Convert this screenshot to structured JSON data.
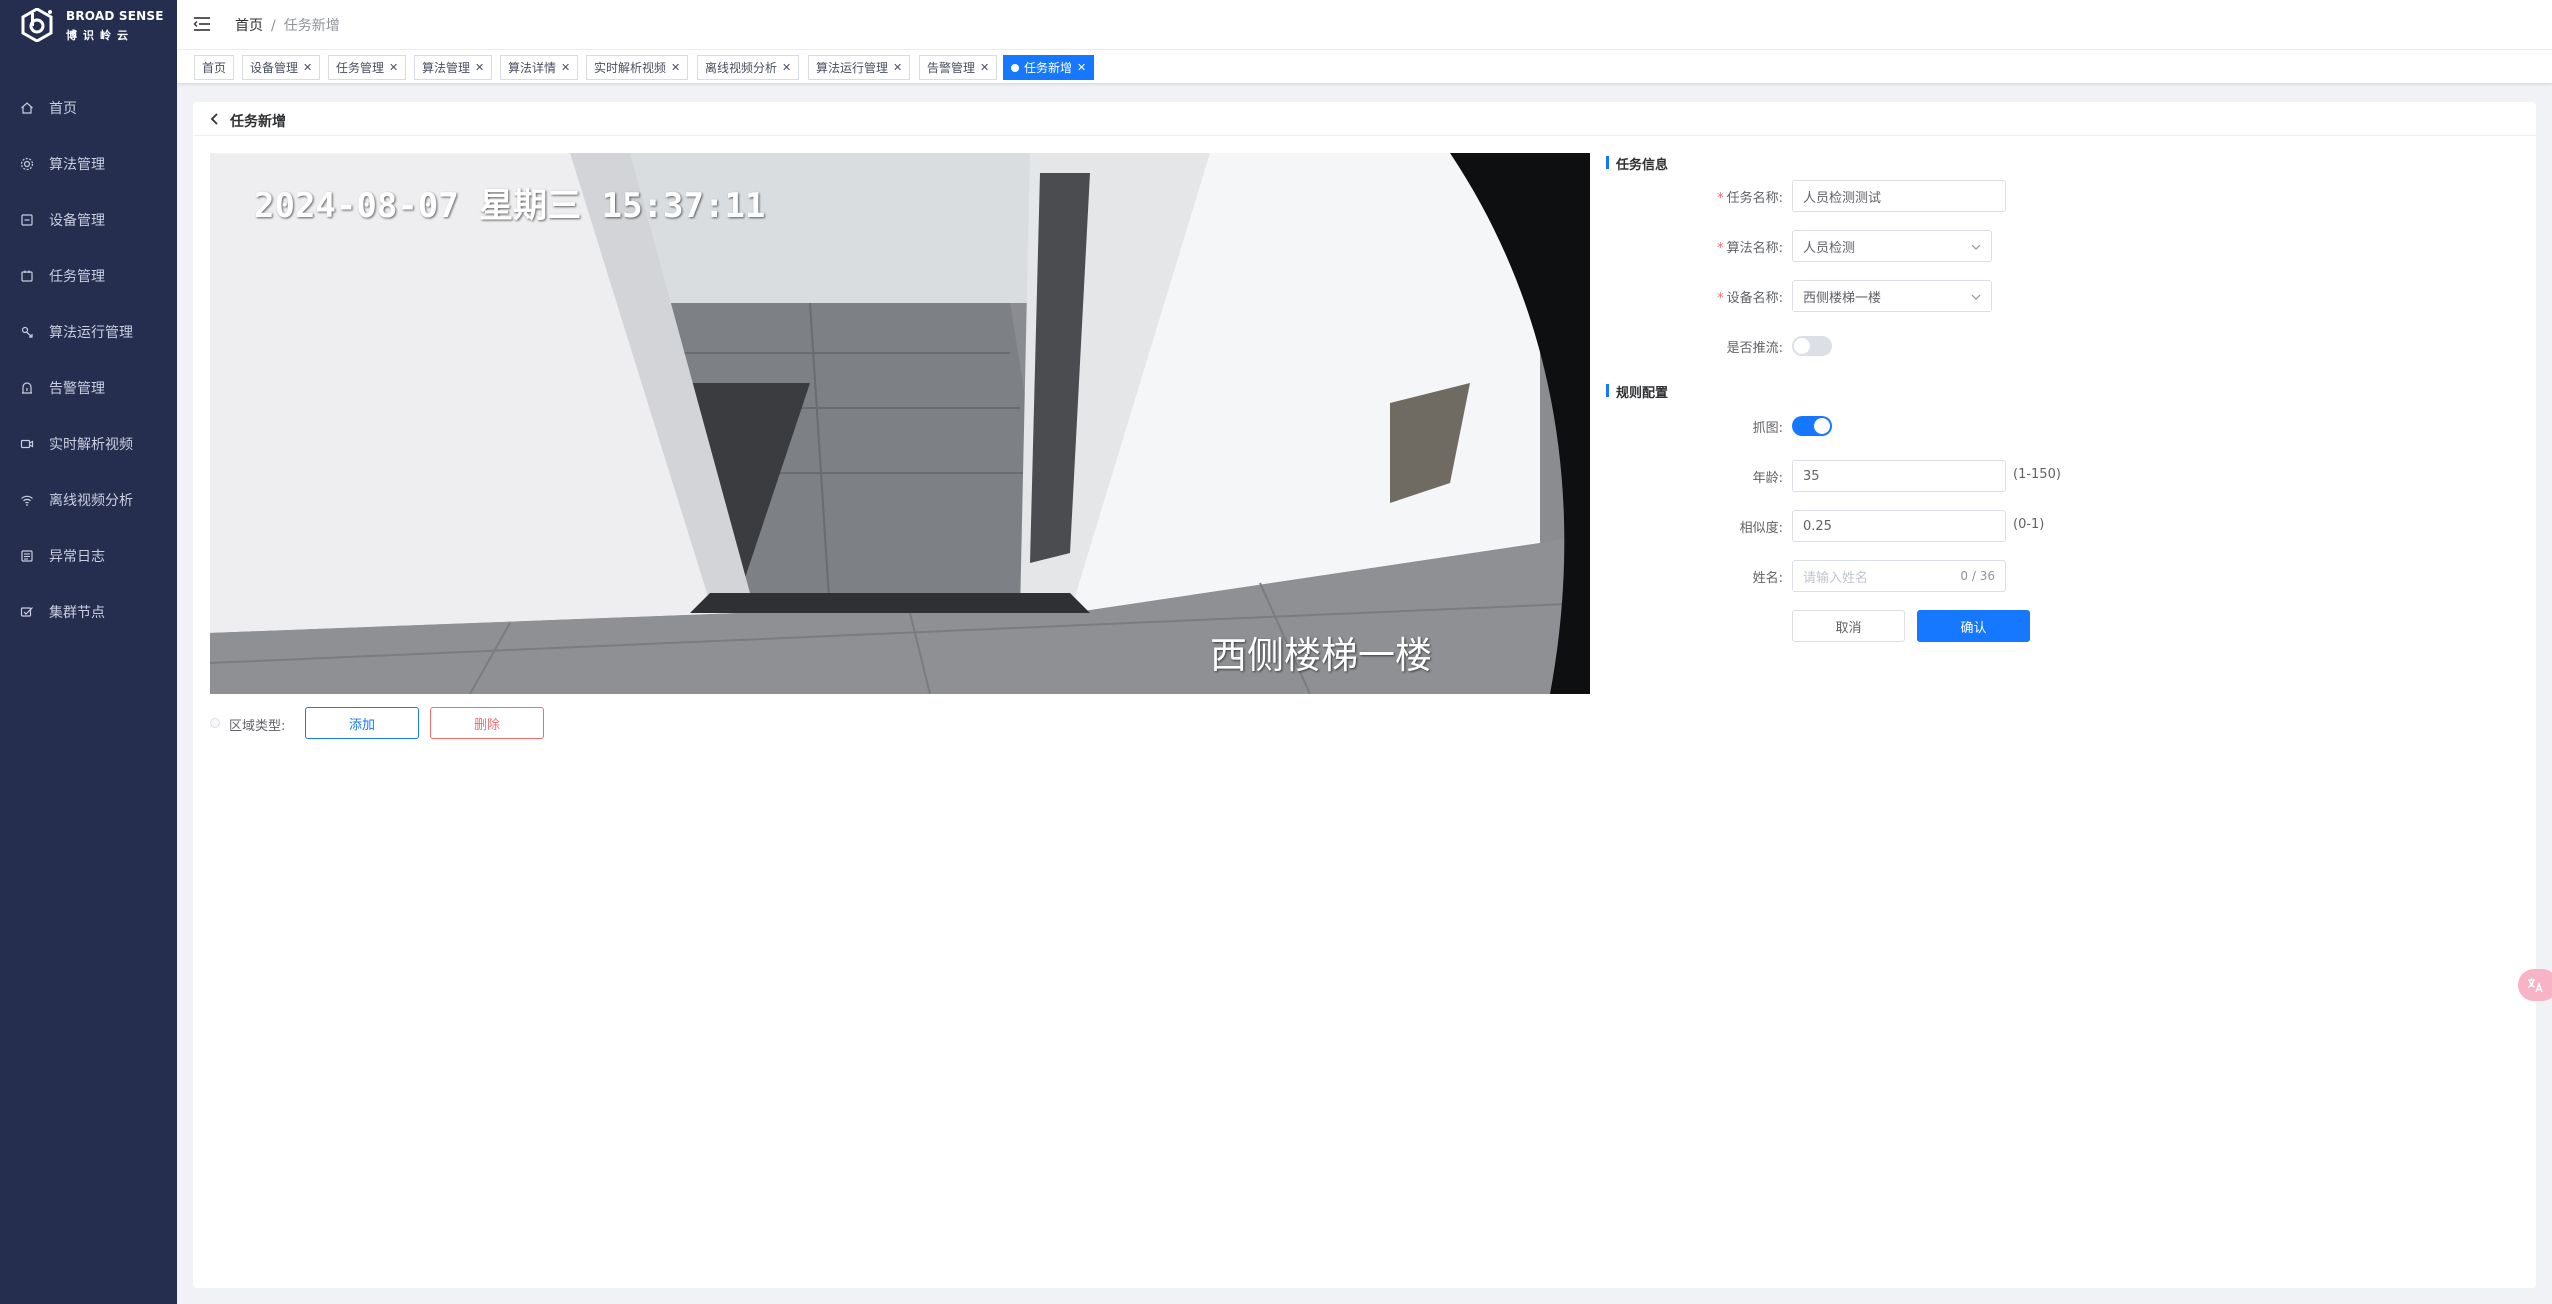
{
  "brand": {
    "name_en": "BROAD SENSE",
    "name_cn": "博识岭云"
  },
  "sidebar": {
    "items": [
      {
        "label": "首页",
        "icon": "home-icon"
      },
      {
        "label": "算法管理",
        "icon": "algorithm-icon"
      },
      {
        "label": "设备管理",
        "icon": "device-icon"
      },
      {
        "label": "任务管理",
        "icon": "task-icon"
      },
      {
        "label": "算法运行管理",
        "icon": "algorithm-run-icon"
      },
      {
        "label": "告警管理",
        "icon": "alarm-icon"
      },
      {
        "label": "实时解析视频",
        "icon": "video-camera-icon"
      },
      {
        "label": "离线视频分析",
        "icon": "wifi-icon"
      },
      {
        "label": "异常日志",
        "icon": "log-icon"
      },
      {
        "label": "集群节点",
        "icon": "cluster-icon"
      }
    ]
  },
  "breadcrumb": {
    "home": "首页",
    "separator": "/",
    "current": "任务新增"
  },
  "tags": [
    {
      "label": "首页",
      "closable": false,
      "active": false
    },
    {
      "label": "设备管理",
      "closable": true,
      "active": false
    },
    {
      "label": "任务管理",
      "closable": true,
      "active": false
    },
    {
      "label": "算法管理",
      "closable": true,
      "active": false
    },
    {
      "label": "算法详情",
      "closable": true,
      "active": false
    },
    {
      "label": "实时解析视频",
      "closable": true,
      "active": false
    },
    {
      "label": "离线视频分析",
      "closable": true,
      "active": false
    },
    {
      "label": "算法运行管理",
      "closable": true,
      "active": false
    },
    {
      "label": "告警管理",
      "closable": true,
      "active": false
    },
    {
      "label": "任务新增",
      "closable": true,
      "active": true
    }
  ],
  "page": {
    "title": "任务新增"
  },
  "video": {
    "timestamp": "2024-08-07 星期三 15:37:11",
    "camera_name": "西侧楼梯一楼"
  },
  "region": {
    "label": "区域类型:",
    "add_label": "添加",
    "delete_label": "删除"
  },
  "task_info": {
    "section_title": "任务信息",
    "task_name": {
      "label": "任务名称:",
      "value": "人员检测测试",
      "required": true
    },
    "algorithm_name": {
      "label": "算法名称:",
      "value": "人员检测",
      "required": true
    },
    "device_name": {
      "label": "设备名称:",
      "value": "西侧楼梯一楼",
      "required": true
    },
    "push_stream": {
      "label": "是否推流:",
      "enabled": false
    }
  },
  "rule_config": {
    "section_title": "规则配置",
    "capture": {
      "label": "抓图:",
      "enabled": true
    },
    "age": {
      "label": "年龄:",
      "value": "35",
      "hint": "(1-150)"
    },
    "similarity": {
      "label": "相似度:",
      "value": "0.25",
      "hint": "(0-1)"
    },
    "name": {
      "label": "姓名:",
      "placeholder": "请输入姓名",
      "counter": "0 / 36"
    }
  },
  "actions": {
    "cancel_label": "取消",
    "confirm_label": "确认"
  },
  "colors": {
    "sidebar_bg": "#252e4f",
    "primary": "#1677ff",
    "danger": "#f56c6c"
  }
}
